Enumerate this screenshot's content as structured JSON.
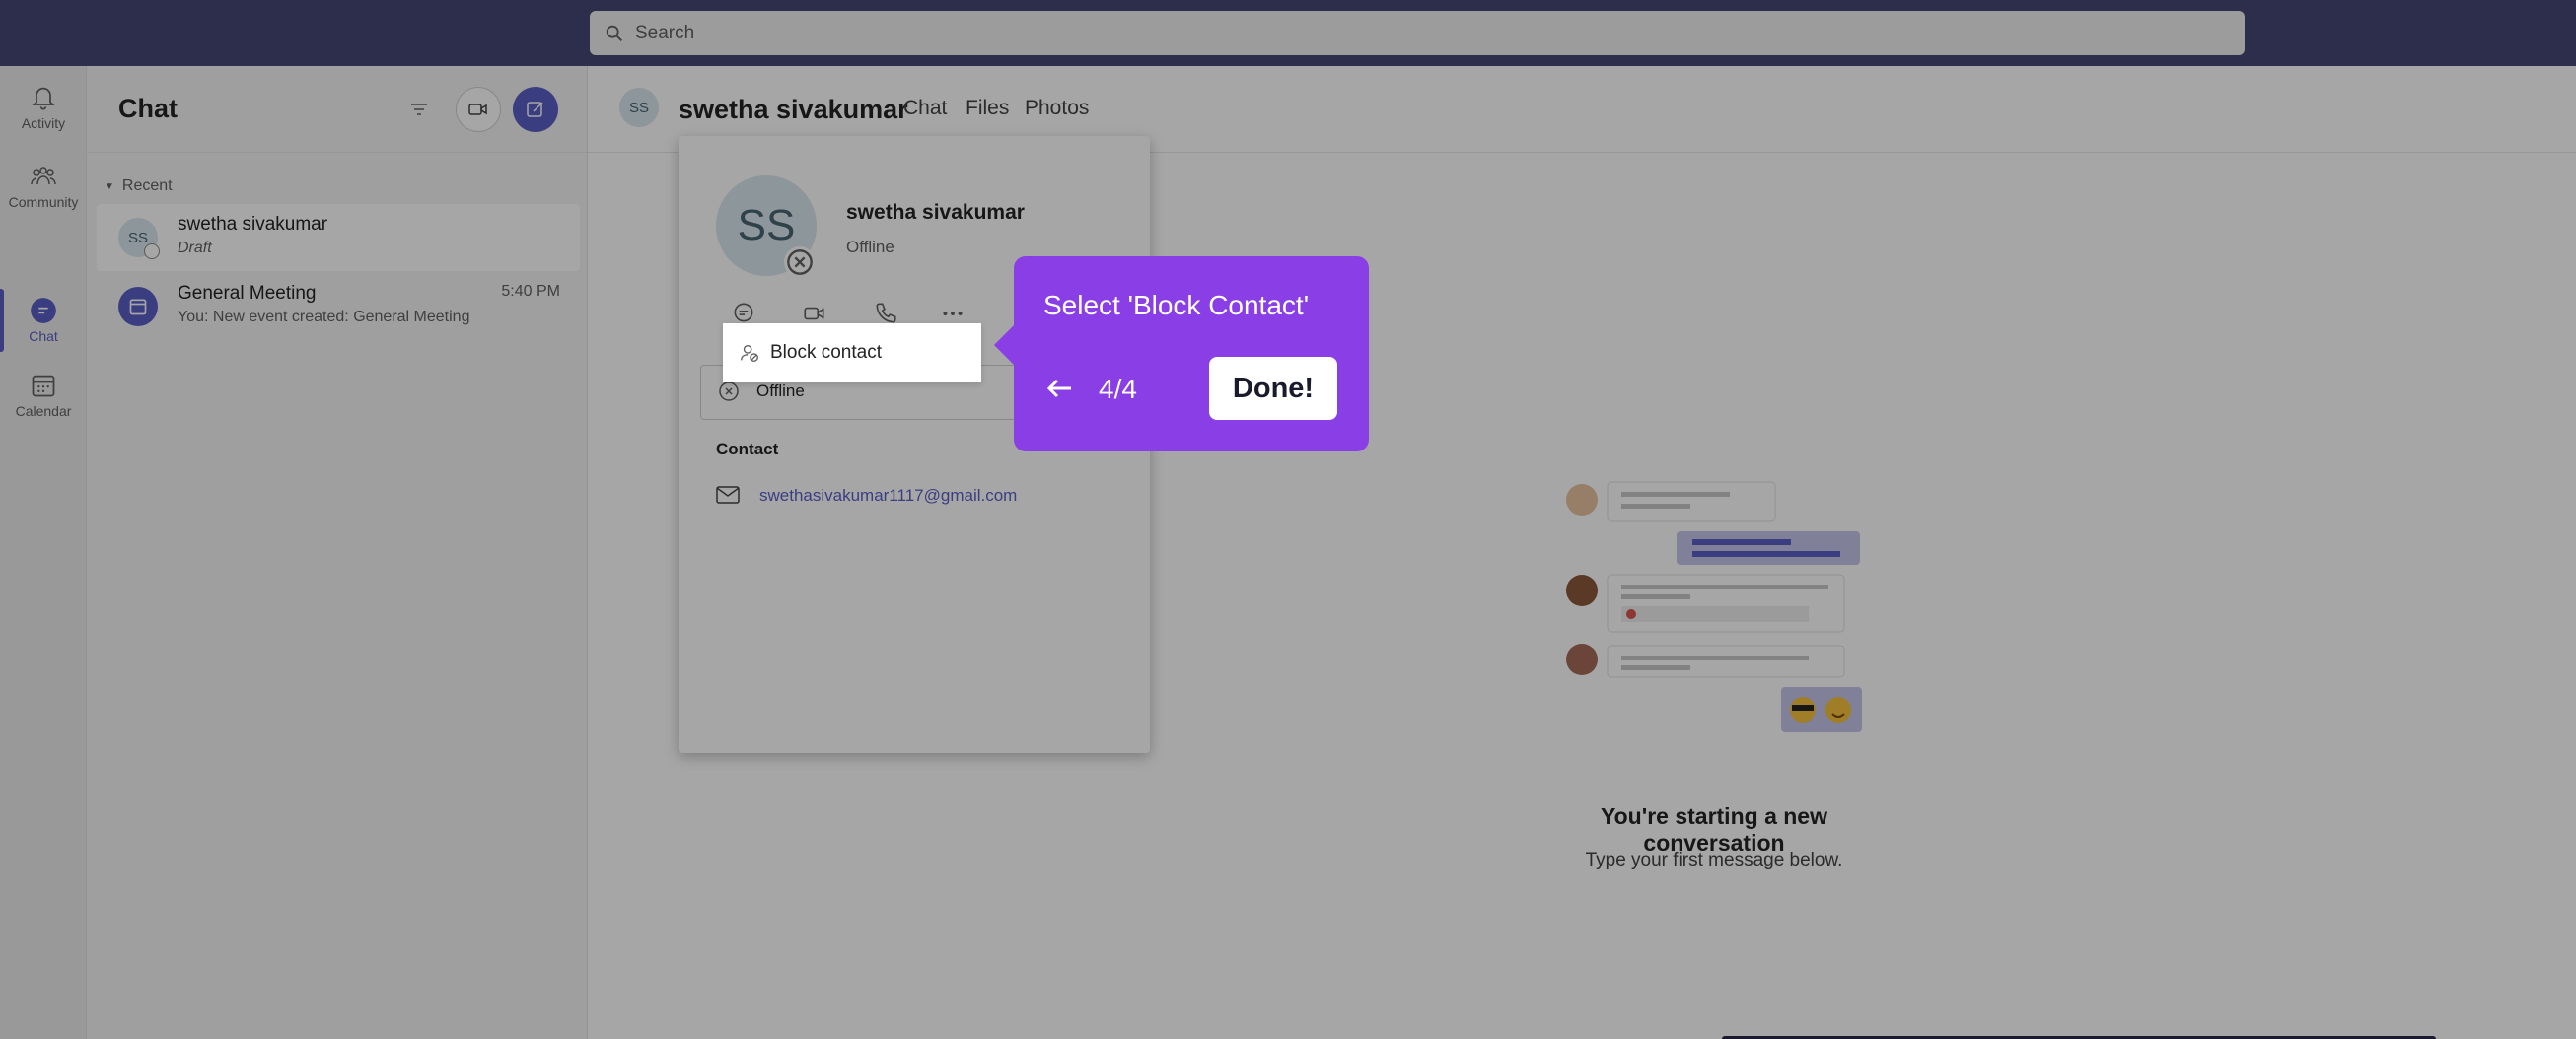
{
  "search": {
    "placeholder": "Search"
  },
  "rail": {
    "items": [
      {
        "label": "Activity",
        "icon": "bell-icon"
      },
      {
        "label": "Community",
        "icon": "community-icon"
      },
      {
        "label": "Chat",
        "icon": "chat-icon"
      },
      {
        "label": "Calendar",
        "icon": "calendar-icon"
      }
    ],
    "active": "Chat"
  },
  "chatlist": {
    "title": "Chat",
    "section_label": "Recent",
    "chats": [
      {
        "avatar": "SS",
        "name": "swetha sivakumar",
        "sub": "Draft",
        "time": ""
      },
      {
        "avatar": "",
        "name": "General Meeting",
        "sub": "You: New event created: General Meeting",
        "time": "5:40 PM"
      }
    ]
  },
  "main": {
    "avatar": "SS",
    "name": "swetha sivakumar",
    "tabs": [
      "Chat",
      "Files",
      "Photos"
    ],
    "empty_title": "You're starting a new conversation",
    "empty_sub": "Type your first message below."
  },
  "profile": {
    "avatar": "SS",
    "name": "swetha sivakumar",
    "status": "Offline",
    "status_row": "Offline",
    "section": "Contact",
    "email": "swethasivakumar1117@gmail.com"
  },
  "menu": {
    "block_label": "Block contact"
  },
  "tooltip": {
    "title": "Select 'Block Contact'",
    "step": "4/4",
    "done_label": "Done!"
  },
  "colors": {
    "topbar": "#464775",
    "accent": "#5b5fc7",
    "tooltip": "#8a3ee5"
  }
}
